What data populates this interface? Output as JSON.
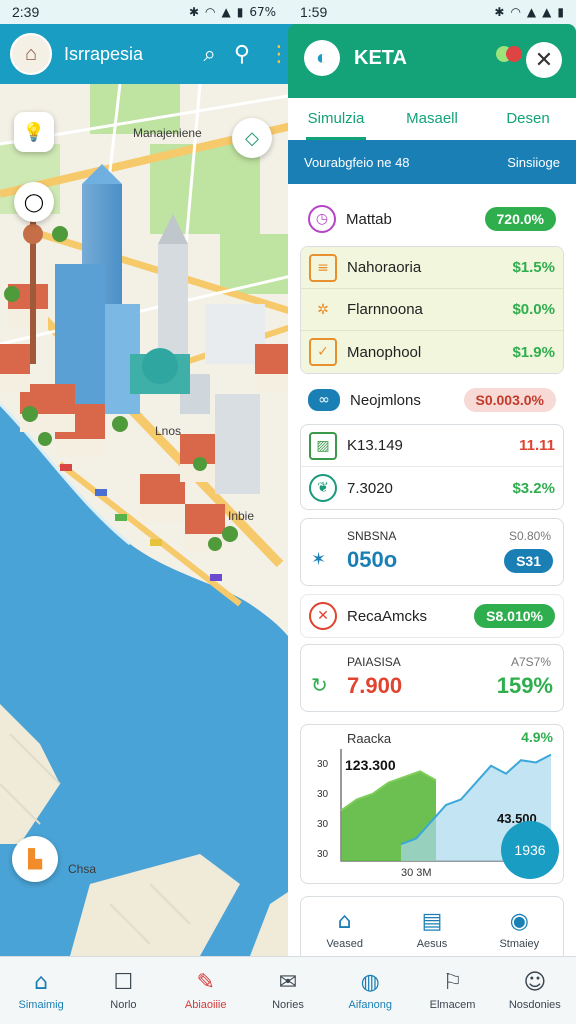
{
  "status_left": {
    "time": "2:39",
    "battery": "67%"
  },
  "status_right": {
    "time": "1:59"
  },
  "map_header": {
    "title": "Isrrapesia",
    "logo_icon": "building-logo-icon"
  },
  "map": {
    "labels": {
      "district": "Manajeniene",
      "street": "Lnos",
      "road": "Inbie",
      "corner": "Chsa"
    }
  },
  "panel": {
    "brand": "KETA",
    "tabs": [
      "Simulzia",
      "Masaell",
      "Desen"
    ],
    "subbar": {
      "left": "Vourabgfeio ne 48",
      "right": "Sinsiioge"
    },
    "row1": {
      "label": "Mattab",
      "value": "720.0%",
      "pill_color": "#2fae4e"
    },
    "group": [
      {
        "label": "Nahoraoria",
        "value": "$1.5%"
      },
      {
        "label": "Flarnnoona",
        "value": "$0.0%"
      },
      {
        "label": "Manophool",
        "value": "$1.9%"
      }
    ],
    "row_neo": {
      "label": "Neojmlons",
      "value": "S0.003.0%"
    },
    "pair": [
      {
        "label": "K13.149",
        "value": "11.11",
        "color": "#e0432f"
      },
      {
        "label": "7.3020",
        "value": "$3.2%",
        "color": "#2fae4e"
      }
    ],
    "block1": {
      "title": "SNBSNA",
      "sub": "S0.80%",
      "big": "050o",
      "pill": "S31"
    },
    "row_reca": {
      "label": "RecaAmcks",
      "pill": "S8.010%"
    },
    "block2": {
      "title": "PAIASISA",
      "sub": "A7S7%",
      "big": "7.900",
      "right_big": "159%"
    },
    "chart_card": {
      "label": "Raacka",
      "top_value": "4.9%",
      "value_a": "123.300",
      "value_b": "43.500",
      "axis": "30 3M",
      "fab": "1936"
    },
    "mini_nav": [
      "Veased",
      "Aesus",
      "Stmaiey"
    ]
  },
  "chart_data": {
    "type": "area",
    "title": "",
    "ylabel": "",
    "ticks_y": [
      "30",
      "30",
      "30",
      "30"
    ],
    "series": [
      {
        "values": [
          0.45,
          0.55,
          0.6,
          0.7,
          0.75,
          0.8,
          0.72
        ]
      },
      {
        "values": [
          0.15,
          0.2,
          0.35,
          0.5,
          0.55,
          0.7,
          0.85,
          0.78,
          0.9,
          0.88,
          0.95
        ]
      }
    ]
  },
  "bottom_nav": [
    {
      "label": "Simaimig",
      "icon": "home-icon"
    },
    {
      "label": "Norlo",
      "icon": "inbox-icon"
    },
    {
      "label": "Abiaoiiie",
      "icon": "pin-icon"
    },
    {
      "label": "Nories",
      "icon": "mail-icon"
    },
    {
      "label": "Aifanong",
      "icon": "globe-icon"
    },
    {
      "label": "Elmacem",
      "icon": "runner-icon"
    },
    {
      "label": "Nosdonies",
      "icon": "user-icon"
    }
  ]
}
